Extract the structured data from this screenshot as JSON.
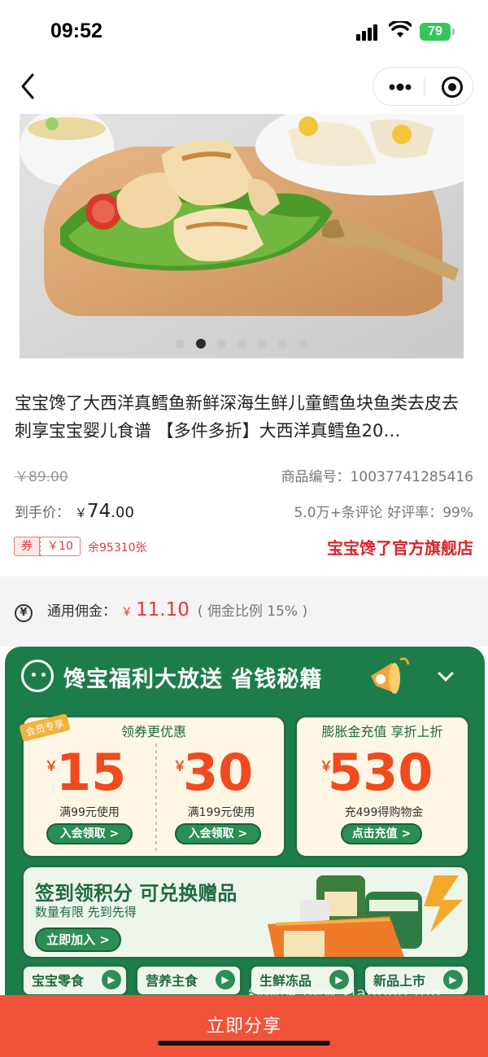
{
  "status": {
    "time": "09:52",
    "battery": "79"
  },
  "nav": {
    "back_icon": "chevron-left-icon",
    "more_icon": "more-dots-icon",
    "close_icon": "target-icon"
  },
  "carousel": {
    "count": 7,
    "active_index": 1
  },
  "product": {
    "title": "宝宝馋了大西洋真鳕鱼新鲜深海生鲜儿童鳕鱼块鱼类去皮去刺享宝宝婴儿食谱 【多件多折】大西洋真鳕鱼20…",
    "original_price": "￥89.00",
    "sku": "商品编号：10037741285416",
    "final_label": "到手价：",
    "final_yen": "￥",
    "final_int": "74",
    "final_dec": ".00",
    "reviews": "5.0万+条评论  好评率：99%"
  },
  "coupon": {
    "tag": "券",
    "amount": "￥10",
    "remaining": "余95310张"
  },
  "shop": {
    "name": "宝宝馋了官方旗舰店"
  },
  "commission": {
    "icon": "yen-circle-icon",
    "label": "通用佣金：",
    "yen": "￥",
    "value": "11.10",
    "rate": "( 佣金比例 15% )"
  },
  "promo": {
    "title": "馋宝福利大放送 省钱秘籍",
    "coupons_head": "领券更优惠",
    "vip_tag": "会员专享",
    "c1_yen": "￥",
    "c1_value": "15",
    "c1_cond": "满99元使用",
    "c1_btn": "入会领取 >",
    "c2_yen": "￥",
    "c2_value": "30",
    "c2_cond": "满199元使用",
    "c2_btn": "入会领取 >",
    "recharge_head": "膨胀金充值 享折上折",
    "r_yen": "￥",
    "r_value": "530",
    "r_cond": "充499得购物金",
    "r_btn": "点击充值 >",
    "signin_title": "签到领积分 可兑换赠品",
    "signin_sub": "数量有限 先到先得",
    "signin_btn": "立即加入 >",
    "categories": [
      "宝宝零食",
      "营养主食",
      "生鲜冻品",
      "新品上市"
    ]
  },
  "watermark": "线报酷 new.xianbao.fun",
  "share": {
    "label": "立即分享"
  },
  "colors": {
    "accent_red": "#f05338",
    "promo_green": "#1d7d4a",
    "price_red": "#e33333"
  }
}
